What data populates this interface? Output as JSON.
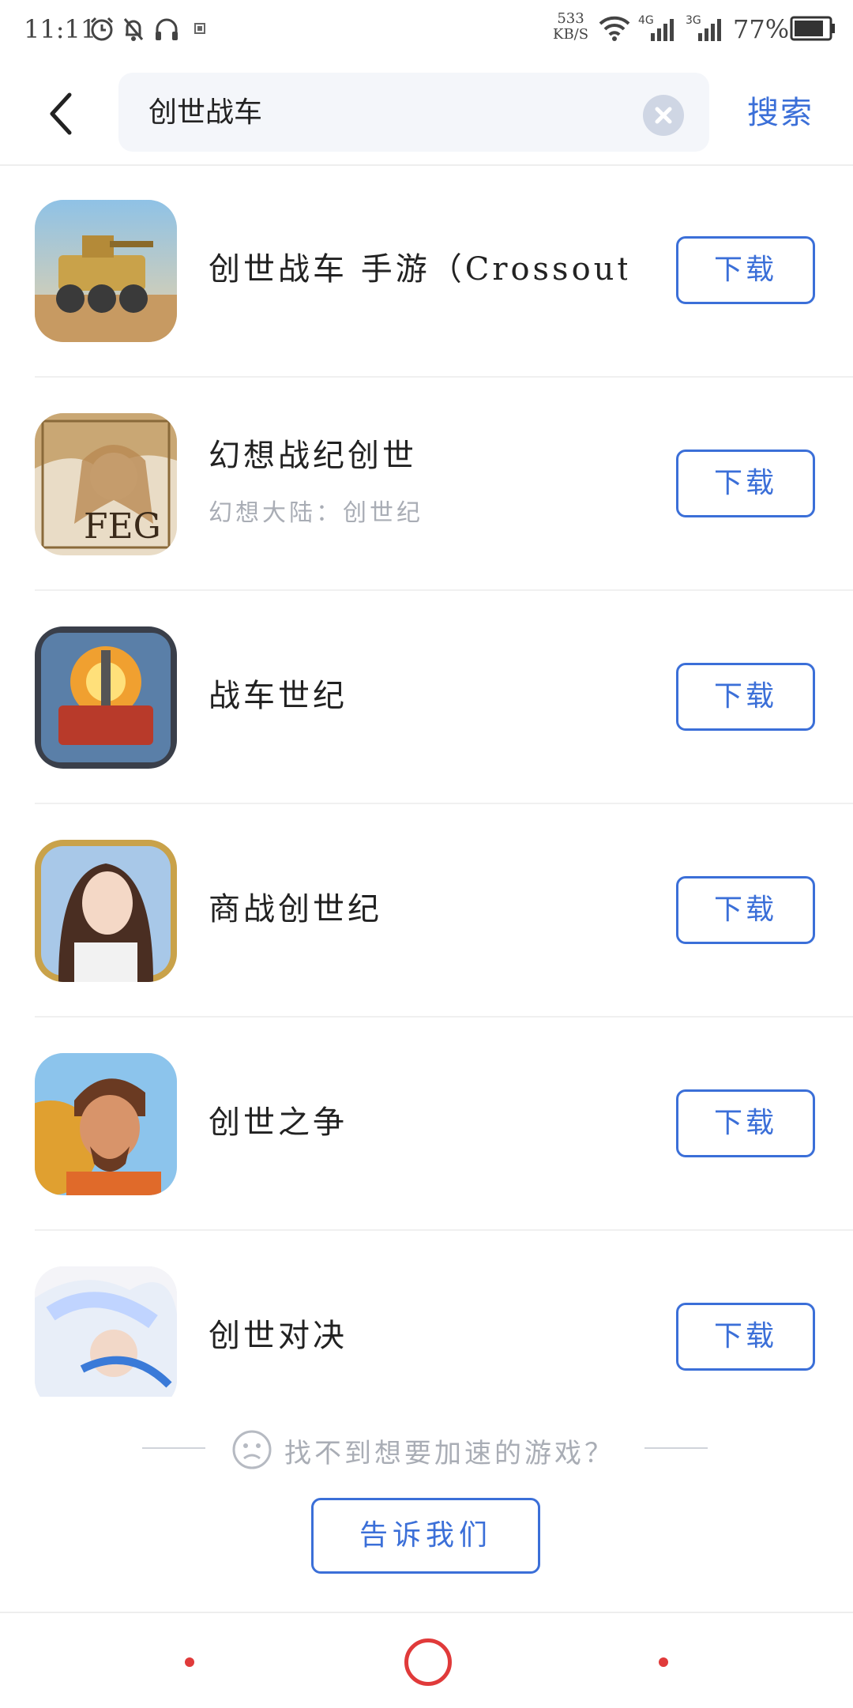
{
  "status_bar": {
    "time": "11:11",
    "net_speed": "533",
    "net_unit": "KB/S",
    "signal1": "4G",
    "signal2": "3G",
    "battery": "77%"
  },
  "header": {
    "search_value": "创世战车",
    "search_button": "搜索"
  },
  "results": [
    {
      "title": "创世战车 手游（Crossout）",
      "subtitle": "",
      "button": "下载"
    },
    {
      "title": "幻想战纪创世",
      "subtitle": "幻想大陆：创世纪",
      "button": "下载"
    },
    {
      "title": "战车世纪",
      "subtitle": "",
      "button": "下载"
    },
    {
      "title": "商战创世纪",
      "subtitle": "",
      "button": "下载"
    },
    {
      "title": "创世之争",
      "subtitle": "",
      "button": "下载"
    },
    {
      "title": "创世对决",
      "subtitle": "",
      "button": "下载"
    }
  ],
  "icon_logo_text": "FEG",
  "footer": {
    "hint": "找不到想要加速的游戏？",
    "tell_button": "告诉我们"
  }
}
